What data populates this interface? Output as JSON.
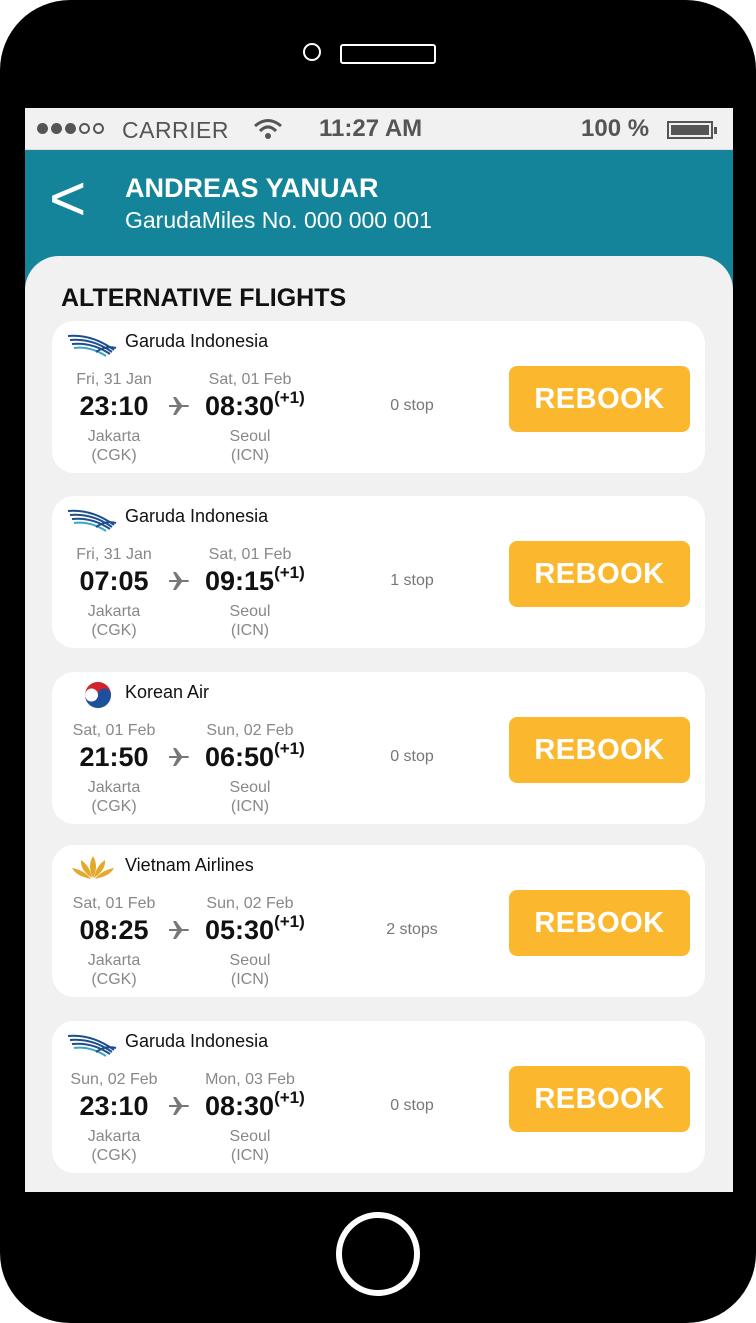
{
  "status_bar": {
    "carrier": "CARRIER",
    "time": "11:27 AM",
    "battery": "100 %"
  },
  "header": {
    "back_icon": "<",
    "passenger_name": "ANDREAS YANUAR",
    "miles_number": "GarudaMiles No. 000 000 001"
  },
  "section_title": "ALTERNATIVE FLIGHTS",
  "colors": {
    "header": "#14849b",
    "rebook": "#fbb82f",
    "background": "#f1f1f1"
  },
  "flights": [
    {
      "airline": "Garuda Indonesia",
      "logo": "garuda-logo-icon",
      "dep_date": "Fri, 31 Jan",
      "dep_time": "23:10",
      "dep_city": "Jakarta",
      "dep_code": "(CGK)",
      "arr_date": "Sat, 01 Feb",
      "arr_time": "08:30",
      "arr_offset": "(+1)",
      "arr_city": "Seoul",
      "arr_code": "(ICN)",
      "stops": "0 stop",
      "action": "REBOOK"
    },
    {
      "airline": "Garuda Indonesia",
      "logo": "garuda-logo-icon",
      "dep_date": "Fri, 31 Jan",
      "dep_time": "07:05",
      "dep_city": "Jakarta",
      "dep_code": "(CGK)",
      "arr_date": "Sat, 01 Feb",
      "arr_time": "09:15",
      "arr_offset": "(+1)",
      "arr_city": "Seoul",
      "arr_code": "(ICN)",
      "stops": "1 stop",
      "action": "REBOOK"
    },
    {
      "airline": "Korean Air",
      "logo": "korean-air-logo-icon",
      "dep_date": "Sat, 01 Feb",
      "dep_time": "21:50",
      "dep_city": "Jakarta",
      "dep_code": "(CGK)",
      "arr_date": "Sun, 02 Feb",
      "arr_time": "06:50",
      "arr_offset": "(+1)",
      "arr_city": "Seoul",
      "arr_code": "(ICN)",
      "stops": "0 stop",
      "action": "REBOOK"
    },
    {
      "airline": "Vietnam Airlines",
      "logo": "vietnam-airlines-logo-icon",
      "dep_date": "Sat, 01 Feb",
      "dep_time": "08:25",
      "dep_city": "Jakarta",
      "dep_code": "(CGK)",
      "arr_date": "Sun, 02 Feb",
      "arr_time": "05:30",
      "arr_offset": "(+1)",
      "arr_city": "Seoul",
      "arr_code": "(ICN)",
      "stops": "2 stops",
      "action": "REBOOK"
    },
    {
      "airline": "Garuda Indonesia",
      "logo": "garuda-logo-icon",
      "dep_date": "Sun, 02 Feb",
      "dep_time": "23:10",
      "dep_city": "Jakarta",
      "dep_code": "(CGK)",
      "arr_date": "Mon, 03 Feb",
      "arr_time": "08:30",
      "arr_offset": "(+1)",
      "arr_city": "Seoul",
      "arr_code": "(ICN)",
      "stops": "0 stop",
      "action": "REBOOK"
    }
  ]
}
